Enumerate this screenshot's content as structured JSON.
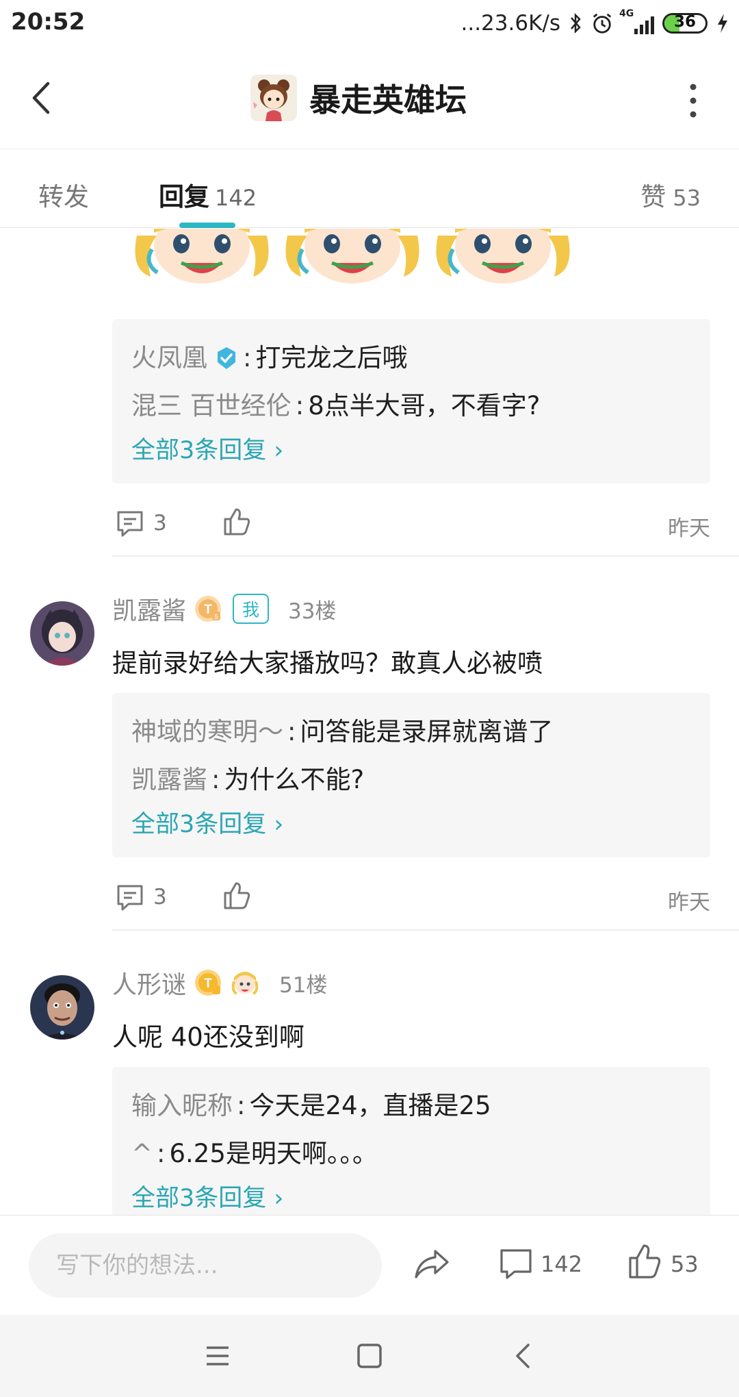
{
  "status_bar": {
    "time": "20:52",
    "net_speed": "...23.6K/s",
    "network": "4G",
    "battery": "36",
    "battery_level_pct": 36,
    "icons": [
      "bluetooth-icon",
      "alarm-icon",
      "signal-icon",
      "battery-icon",
      "charging-icon"
    ]
  },
  "header": {
    "title": "暴走英雄坛",
    "icons": [
      "back-arrow-icon",
      "forum-avatar",
      "more-vertical-icon"
    ]
  },
  "tabs": {
    "forward_label": "转发",
    "reply_label": "回复",
    "reply_count": "142",
    "like_label": "赞",
    "like_count": "53",
    "accent": "#2cb7c2"
  },
  "thread1": {
    "replies": [
      {
        "name": "火凤凰",
        "sep": ":",
        "text": "打完龙之后哦"
      },
      {
        "name": "混三 百世经伦",
        "sep": ":",
        "text": "8点半大哥，不看字?"
      }
    ],
    "all_label": "全部3条回复 ›",
    "comment_count": "3",
    "time": "昨天"
  },
  "post2": {
    "username": "凯露酱",
    "badge": "我",
    "floor": "33楼",
    "text": "提前录好给大家播放吗？敢真人必被喷",
    "replies": [
      {
        "name": "神域的寒明～",
        "sep": ":",
        "text": "问答能是录屏就离谱了"
      },
      {
        "name": "凯露酱",
        "sep": ":",
        "text": "为什么不能?"
      }
    ],
    "all_label": "全部3条回复 ›",
    "comment_count": "3",
    "time": "昨天"
  },
  "post3": {
    "username": "人形谜",
    "floor": "51楼",
    "text": "人呢 40还没到啊",
    "replies": [
      {
        "name": "输入昵称",
        "sep": ":",
        "text": "今天是24，直播是25"
      },
      {
        "name": "^",
        "sep": ":",
        "text": "6.25是明天啊。。。"
      }
    ],
    "all_label": "全部3条回复 ›"
  },
  "bottom_bar": {
    "input_placeholder": "写下你的想法...",
    "comment_count": "142",
    "like_count": "53",
    "accent_link": "#2aa6b3"
  }
}
